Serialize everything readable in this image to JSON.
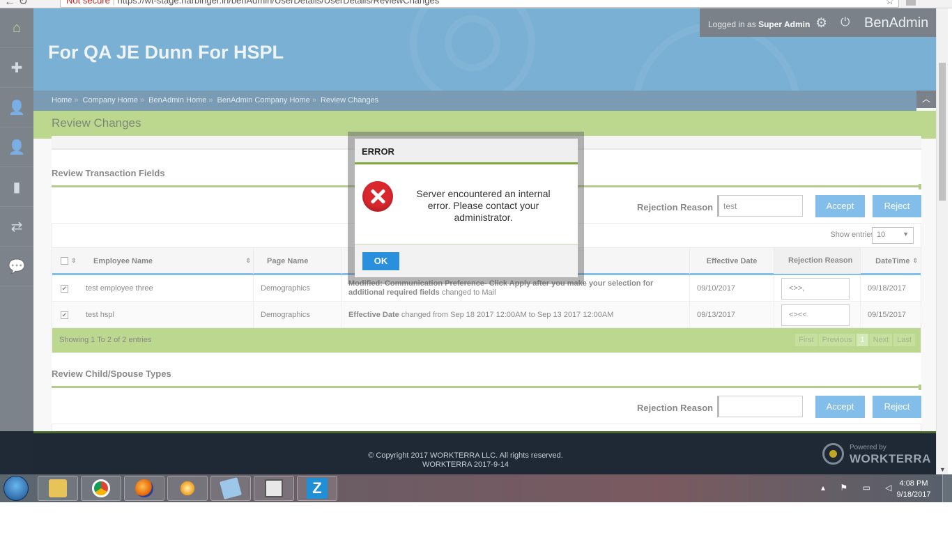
{
  "browser": {
    "warning": "Not secure",
    "url_text": "https://wt-stage.harbinger.in/benAdmin/UserDetails/UserDetails/ReviewChanges"
  },
  "header": {
    "company_title": "For QA JE Dunn For HSPL",
    "logged_in_prefix": "Logged in as",
    "logged_in_user": "Super Admin",
    "brand": "BenAdmin"
  },
  "breadcrumb": [
    "Home",
    "Company Home",
    "BenAdmin Home",
    "BenAdmin Company Home",
    "Review Changes"
  ],
  "breadcrumb_sep": "»",
  "page_title": "Review Changes",
  "transaction_section": {
    "title": "Review Transaction Fields",
    "rejection_label": "Rejection Reason",
    "rejection_value": "test",
    "accept_label": "Accept",
    "reject_label": "Reject",
    "show_entries_label": "Show entries",
    "show_entries_value": "10",
    "columns": {
      "employee": "Employee Name",
      "page": "Page Name",
      "effective": "Effective Date",
      "reason": "Rejection Reason",
      "datetime": "DateTime"
    },
    "rows": [
      {
        "checked": "✔",
        "employee": "test employee three",
        "page": "Demographics",
        "change_bold": "Modified: Communication Preference- Click Apply after you make your selection for additional required fields",
        "change_rest": " changed to Mail",
        "effective": "09/10/2017",
        "reason": "<>>,",
        "datetime": "09/18/2017"
      },
      {
        "checked": "✔",
        "employee": "test hspl",
        "page": "Demographics",
        "change_bold": "Effective Date",
        "change_rest": " changed from Sep 18 2017 12:00AM to Sep 13 2017 12:00AM",
        "effective": "09/13/2017",
        "reason": "<><<",
        "datetime": "09/15/2017"
      }
    ],
    "info": "Showing 1 To 2 of 2 entries",
    "pager": {
      "first": "First",
      "previous": "Previous",
      "current": "1",
      "next": "Next",
      "last": "Last"
    }
  },
  "child_section": {
    "title": "Review Child/Spouse Types",
    "rejection_label": "Rejection Reason",
    "rejection_value": "",
    "accept_label": "Accept",
    "reject_label": "Reject"
  },
  "footer": {
    "copyright": "© Copyright 2017 WORKTERRA LLC. All rights reserved.",
    "version": "WORKTERRA 2017-9-14",
    "powered_by": "Powered by",
    "powered_brand": "WORKTERRA"
  },
  "modal": {
    "title": "ERROR",
    "message": "Server encountered an internal error. Please contact your administrator.",
    "ok_label": "OK"
  },
  "taskbar": {
    "time": "4:08 PM",
    "date": "9/18/2017",
    "apps": [
      "file-explorer",
      "chrome",
      "firefox",
      "burner",
      "notepad",
      "clipboard",
      "zoom"
    ]
  },
  "colors": {
    "accent_blue": "#2a8fdc",
    "accent_green": "#8cbc3f",
    "error_red": "#d9272e",
    "header_blue": "#1b78b6"
  }
}
